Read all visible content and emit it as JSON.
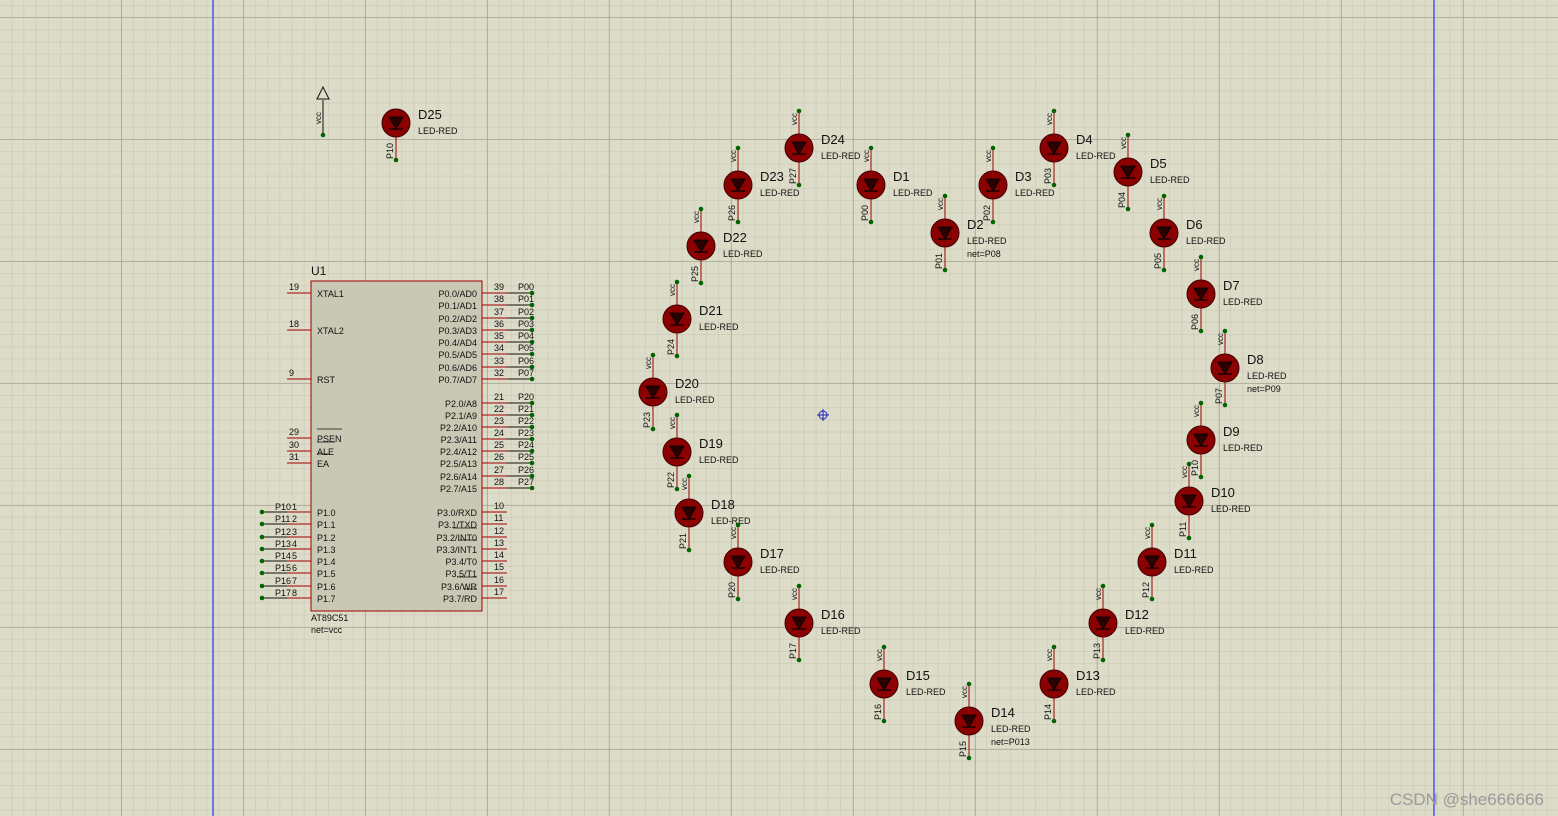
{
  "mcu": {
    "ref": "U1",
    "part": "AT89C51",
    "net": "net=vcc",
    "left_pins": [
      {
        "num": "19",
        "name": "XTAL1"
      },
      {
        "num": "18",
        "name": "XTAL2"
      },
      {
        "num": "9",
        "name": "RST"
      },
      {
        "num": "29",
        "name": "PSEN"
      },
      {
        "num": "30",
        "name": "ALE"
      },
      {
        "num": "31",
        "name": "EA"
      },
      {
        "num": "1",
        "name": "P1.0",
        "net": "P10"
      },
      {
        "num": "2",
        "name": "P1.1",
        "net": "P11"
      },
      {
        "num": "3",
        "name": "P1.2",
        "net": "P12"
      },
      {
        "num": "4",
        "name": "P1.3",
        "net": "P13"
      },
      {
        "num": "5",
        "name": "P1.4",
        "net": "P14"
      },
      {
        "num": "6",
        "name": "P1.5",
        "net": "P15"
      },
      {
        "num": "7",
        "name": "P1.6",
        "net": "P16"
      },
      {
        "num": "8",
        "name": "P1.7",
        "net": "P17"
      }
    ],
    "right_pins": [
      {
        "num": "39",
        "name": "P0.0/AD0",
        "net": "P00"
      },
      {
        "num": "38",
        "name": "P0.1/AD1",
        "net": "P01"
      },
      {
        "num": "37",
        "name": "P0.2/AD2",
        "net": "P02"
      },
      {
        "num": "36",
        "name": "P0.3/AD3",
        "net": "P03"
      },
      {
        "num": "35",
        "name": "P0.4/AD4",
        "net": "P04"
      },
      {
        "num": "34",
        "name": "P0.5/AD5",
        "net": "P05"
      },
      {
        "num": "33",
        "name": "P0.6/AD6",
        "net": "P06"
      },
      {
        "num": "32",
        "name": "P0.7/AD7",
        "net": "P07"
      },
      {
        "num": "21",
        "name": "P2.0/A8",
        "net": "P20"
      },
      {
        "num": "22",
        "name": "P2.1/A9",
        "net": "P21"
      },
      {
        "num": "23",
        "name": "P2.2/A10",
        "net": "P22"
      },
      {
        "num": "24",
        "name": "P2.3/A11",
        "net": "P23"
      },
      {
        "num": "25",
        "name": "P2.4/A12",
        "net": "P24"
      },
      {
        "num": "26",
        "name": "P2.5/A13",
        "net": "P25"
      },
      {
        "num": "27",
        "name": "P2.6/A14",
        "net": "P26"
      },
      {
        "num": "28",
        "name": "P2.7/A15",
        "net": "P27"
      },
      {
        "num": "10",
        "name": "P3.0/RXD"
      },
      {
        "num": "11",
        "name": "P3.1/TXD"
      },
      {
        "num": "12",
        "name": "P3.2/INT0"
      },
      {
        "num": "13",
        "name": "P3.3/INT1"
      },
      {
        "num": "14",
        "name": "P3.4/T0"
      },
      {
        "num": "15",
        "name": "P3.5/T1"
      },
      {
        "num": "16",
        "name": "P3.6/WR"
      },
      {
        "num": "17",
        "name": "P3.7/RD"
      }
    ]
  },
  "power_terminal": {
    "label": "vcc"
  },
  "leds": [
    {
      "ref": "D25",
      "part": "LED-RED",
      "top": "",
      "bottom": "P10",
      "net": ""
    },
    {
      "ref": "D24",
      "part": "LED-RED",
      "top": "vcc",
      "bottom": "P27",
      "net": ""
    },
    {
      "ref": "D23",
      "part": "LED-RED",
      "top": "vcc",
      "bottom": "P26",
      "net": ""
    },
    {
      "ref": "D22",
      "part": "LED-RED",
      "top": "vcc",
      "bottom": "P25",
      "net": ""
    },
    {
      "ref": "D21",
      "part": "LED-RED",
      "top": "vcc",
      "bottom": "P24",
      "net": ""
    },
    {
      "ref": "D20",
      "part": "LED-RED",
      "top": "vcc",
      "bottom": "P23",
      "net": ""
    },
    {
      "ref": "D19",
      "part": "LED-RED",
      "top": "vcc",
      "bottom": "P22",
      "net": ""
    },
    {
      "ref": "D18",
      "part": "LED-RED",
      "top": "vcc",
      "bottom": "P21",
      "net": ""
    },
    {
      "ref": "D17",
      "part": "LED-RED",
      "top": "vcc",
      "bottom": "P20",
      "net": ""
    },
    {
      "ref": "D16",
      "part": "LED-RED",
      "top": "vcc",
      "bottom": "P17",
      "net": ""
    },
    {
      "ref": "D15",
      "part": "LED-RED",
      "top": "vcc",
      "bottom": "P16",
      "net": ""
    },
    {
      "ref": "D14",
      "part": "LED-RED",
      "top": "vcc",
      "bottom": "P15",
      "net": "net=P013"
    },
    {
      "ref": "D13",
      "part": "LED-RED",
      "top": "vcc",
      "bottom": "P14",
      "net": ""
    },
    {
      "ref": "D12",
      "part": "LED-RED",
      "top": "vcc",
      "bottom": "P13",
      "net": ""
    },
    {
      "ref": "D11",
      "part": "LED-RED",
      "top": "vcc",
      "bottom": "P12",
      "net": ""
    },
    {
      "ref": "D10",
      "part": "LED-RED",
      "top": "vcc",
      "bottom": "P11",
      "net": ""
    },
    {
      "ref": "D9",
      "part": "LED-RED",
      "top": "vcc",
      "bottom": "P10",
      "net": ""
    },
    {
      "ref": "D8",
      "part": "LED-RED",
      "top": "vcc",
      "bottom": "P07",
      "net": "net=P09"
    },
    {
      "ref": "D7",
      "part": "LED-RED",
      "top": "vcc",
      "bottom": "P06",
      "net": ""
    },
    {
      "ref": "D6",
      "part": "LED-RED",
      "top": "vcc",
      "bottom": "P05",
      "net": ""
    },
    {
      "ref": "D5",
      "part": "LED-RED",
      "top": "vcc",
      "bottom": "P04",
      "net": ""
    },
    {
      "ref": "D4",
      "part": "LED-RED",
      "top": "vcc",
      "bottom": "P03",
      "net": ""
    },
    {
      "ref": "D3",
      "part": "LED-RED",
      "top": "vcc",
      "bottom": "P02",
      "net": ""
    },
    {
      "ref": "D2",
      "part": "LED-RED",
      "top": "vcc",
      "bottom": "P01",
      "net": "net=P08"
    },
    {
      "ref": "D1",
      "part": "LED-RED",
      "top": "vcc",
      "bottom": "P00",
      "net": ""
    }
  ],
  "watermark": "CSDN @she666666",
  "colors": {
    "wire": "#a00000",
    "led_fill": "#8b0000",
    "body": "#c8c8b4",
    "border_line": "#3a3aff",
    "node": "#006400"
  }
}
